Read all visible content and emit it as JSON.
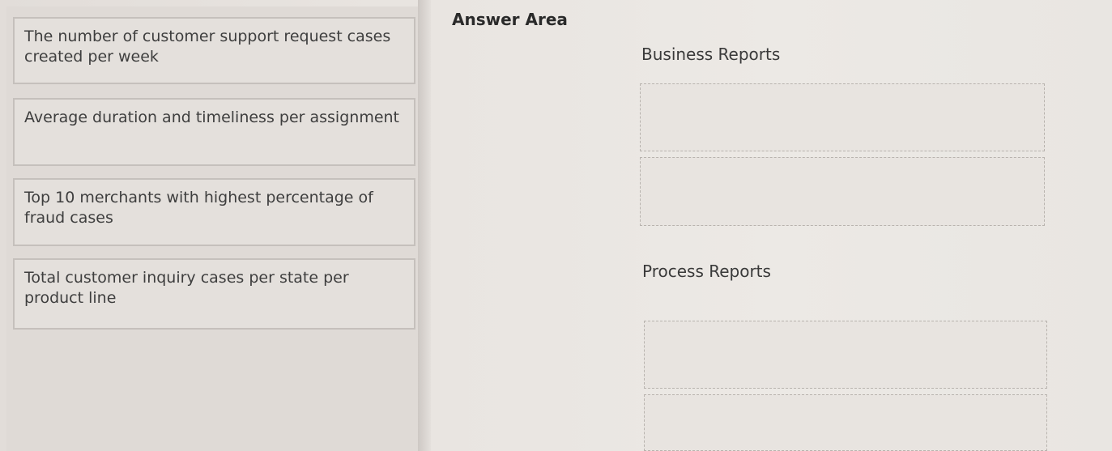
{
  "items": [
    {
      "label": "The number of customer support request cases created per week"
    },
    {
      "label": "Average duration and timeliness per assignment"
    },
    {
      "label": "Top 10 merchants with highest percentage of fraud cases"
    },
    {
      "label": "Total customer inquiry cases per state per product line"
    }
  ],
  "answer_area": {
    "title": "Answer Area",
    "business_reports": {
      "title": "Business Reports"
    },
    "process_reports": {
      "title": "Process Reports"
    }
  }
}
